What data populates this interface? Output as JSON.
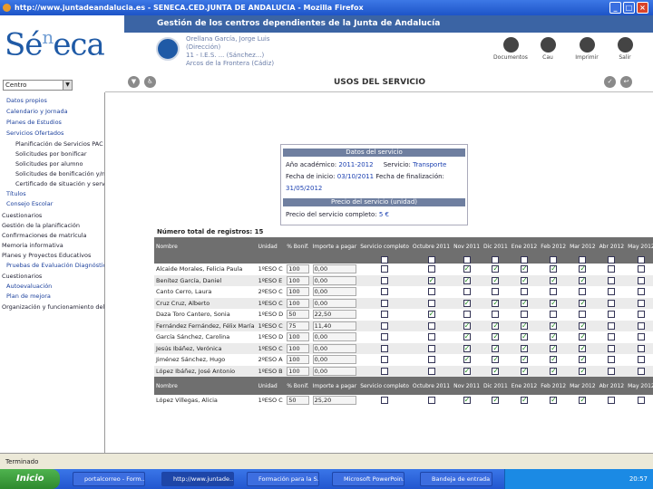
{
  "window": {
    "title": "http://www.juntadeandalucia.es - SENECA.CED.JUNTA DE ANDALUCIA - Mozilla Firefox"
  },
  "header": {
    "band": "Gestión de los centros dependientes de la Junta de Andalucía",
    "logo": "Séneca",
    "user": [
      "Orellana García, Jorge Luis",
      "(Dirección)",
      "11 - I.E.S. ... (Sánchez...)",
      "Arcos de la Frontera (Cádiz)"
    ],
    "actions": [
      "Documentos",
      "Cau",
      "Imprimir",
      "Salir"
    ]
  },
  "sidebar": {
    "selector": "Centro",
    "items": [
      "Datos propios",
      "Calendario y Jornada",
      "Planes de Estudios",
      "Servicios Ofertados",
      "Planificación de Servicios PAC",
      "Solicitudes por bonificar",
      "Solicitudes por alumno",
      "Solicitudes de bonificación y/no",
      "Certificado de situación y servicios",
      "Títulos",
      "Consejo Escolar",
      "Cuestionarios",
      "Gestión de la planificación",
      "Confirmaciones de matrícula",
      "Memoria informativa",
      "Planes y Proyectos Educativos",
      "Pruebas de Evaluación Diagnóstico",
      "Cuestionarios",
      "Autoevaluación",
      "Plan de mejora",
      "Organización y funcionamiento del IES"
    ]
  },
  "page": {
    "title": "USOS DEL SERVICIO"
  },
  "panel": {
    "h1": "Datos del servicio",
    "curso_label": "Año académico:",
    "curso": "2011-2012",
    "servicio_label": "Servicio:",
    "servicio": "Transporte",
    "fecha_label": "Fecha de inicio:",
    "fecha_ini": "03/10/2011",
    "fecha_fin_label": "Fecha de finalización:",
    "fecha_fin": "31/05/2012",
    "h2": "Precio del servicio (unidad)",
    "precio_label": "Precio del servicio completo:",
    "precio": "5 €"
  },
  "table": {
    "count": "Número total de registros: 15",
    "headers": [
      "Nombre",
      "Unidad",
      "% Bonif.",
      "Importe a pagar",
      "Servicio completo",
      "Octubre 2011",
      "Nov 2011",
      "Dic 2011",
      "Ene 2012",
      "Feb 2012",
      "Mar 2012",
      "Abr 2012",
      "May 2012"
    ],
    "rows": [
      [
        "Alcaide Morales, Felicia Paula",
        "1ºESO C",
        "100",
        "0,00",
        [
          0,
          0,
          1,
          1,
          1,
          1,
          1,
          0,
          0
        ]
      ],
      [
        "Benítez García, Daniel",
        "1ºESO E",
        "100",
        "0,00",
        [
          0,
          1,
          1,
          1,
          1,
          1,
          1,
          0,
          0
        ]
      ],
      [
        "Canto Cerro, Laura",
        "2ºESO C",
        "100",
        "0,00",
        [
          0,
          0,
          0,
          0,
          0,
          0,
          0,
          0,
          0
        ]
      ],
      [
        "Cruz Cruz, Alberto",
        "1ºESO C",
        "100",
        "0,00",
        [
          0,
          0,
          1,
          1,
          1,
          1,
          1,
          0,
          0
        ]
      ],
      [
        "Daza Toro Cantero, Sonia",
        "1ºESO D",
        "50",
        "22,50",
        [
          0,
          1,
          0,
          0,
          0,
          0,
          0,
          0,
          0
        ]
      ],
      [
        "Fernández Fernández, Félix María",
        "1ºESO C",
        "75",
        "11,40",
        [
          0,
          0,
          1,
          1,
          1,
          1,
          1,
          0,
          0
        ]
      ],
      [
        "García Sánchez, Carolina",
        "1ºESO D",
        "100",
        "0,00",
        [
          0,
          0,
          1,
          1,
          1,
          1,
          1,
          0,
          0
        ]
      ],
      [
        "Jesús Ibáñez, Verónica",
        "1ºESO C",
        "100",
        "0,00",
        [
          0,
          0,
          1,
          1,
          1,
          1,
          1,
          0,
          0
        ]
      ],
      [
        "Jiménez Sánchez, Hugo",
        "2ºESO A",
        "100",
        "0,00",
        [
          0,
          0,
          1,
          1,
          1,
          1,
          1,
          0,
          0
        ]
      ],
      [
        "López Ibáñez, José Antonio",
        "1ºESO B",
        "100",
        "0,00",
        [
          0,
          0,
          1,
          1,
          1,
          1,
          1,
          0,
          0
        ]
      ]
    ],
    "row_last": [
      "López Villegas, Alicia",
      "1ºESO C",
      "50",
      "25,20",
      [
        0,
        0,
        1,
        1,
        1,
        1,
        1,
        0,
        0
      ]
    ]
  },
  "status": {
    "text": "Terminado"
  },
  "taskbar": {
    "start": "Inicio",
    "tasks": [
      "portalcorreo - Form...",
      "http://www.juntade...",
      "Formación para la S...",
      "Microsoft PowerPoin...",
      "Bandeja de entrada -..."
    ],
    "clock": "20:57"
  }
}
